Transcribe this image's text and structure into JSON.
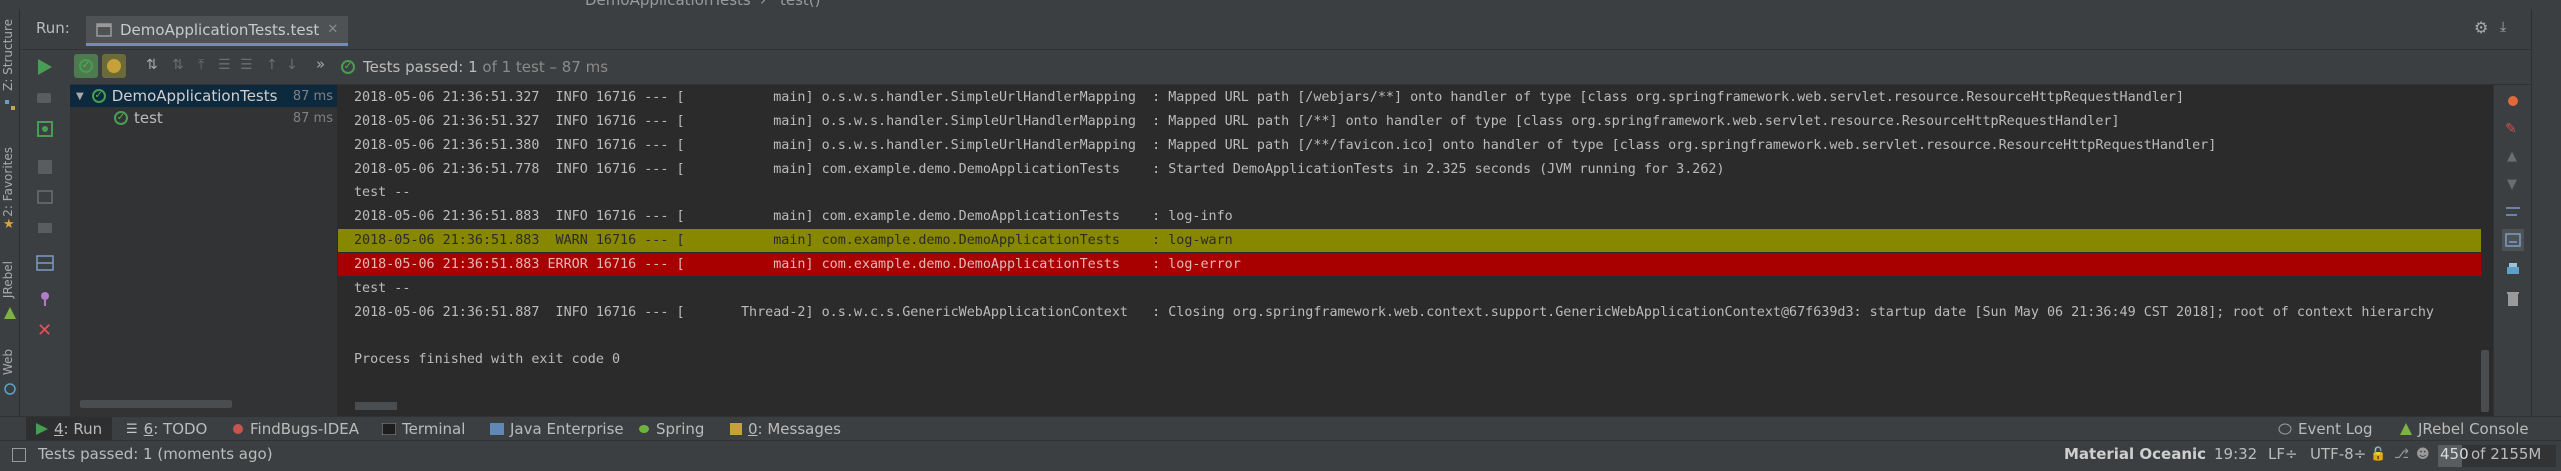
{
  "breadcrumb": {
    "class_name": "DemoApplicationTests",
    "method_name": "test()"
  },
  "left_strip": {
    "structure": "Z: Structure",
    "favorites": "2: Favorites",
    "jrebel": "JRebel",
    "web": "Web"
  },
  "run_panel": {
    "label": "Run:",
    "tab_label": "DemoApplicationTests.test",
    "status_text": "Tests passed:",
    "status_count": "1",
    "status_suffix": "of 1 test – 87 ms",
    "more_chevron": "»"
  },
  "tree": [
    {
      "label": "DemoApplicationTests",
      "time": "87 ms"
    },
    {
      "label": "test",
      "time": "87 ms"
    }
  ],
  "console_lines": [
    {
      "text": "2018-05-06 21:36:51.327  INFO 16716 --- [           main] o.s.w.s.handler.SimpleUrlHandlerMapping  : Mapped URL path [/webjars/**] onto handler of type [class org.springframework.web.servlet.resource.ResourceHttpRequestHandler]",
      "level": "info"
    },
    {
      "text": "2018-05-06 21:36:51.327  INFO 16716 --- [           main] o.s.w.s.handler.SimpleUrlHandlerMapping  : Mapped URL path [/**] onto handler of type [class org.springframework.web.servlet.resource.ResourceHttpRequestHandler]",
      "level": "info"
    },
    {
      "text": "2018-05-06 21:36:51.380  INFO 16716 --- [           main] o.s.w.s.handler.SimpleUrlHandlerMapping  : Mapped URL path [/**/favicon.ico] onto handler of type [class org.springframework.web.servlet.resource.ResourceHttpRequestHandler]",
      "level": "info"
    },
    {
      "text": "2018-05-06 21:36:51.778  INFO 16716 --- [           main] com.example.demo.DemoApplicationTests    : Started DemoApplicationTests in 2.325 seconds (JVM running for 3.262)",
      "level": "info"
    },
    {
      "text": "test --",
      "level": "info"
    },
    {
      "text": "2018-05-06 21:36:51.883  INFO 16716 --- [           main] com.example.demo.DemoApplicationTests    : log-info",
      "level": "info"
    },
    {
      "text": "2018-05-06 21:36:51.883  WARN 16716 --- [           main] com.example.demo.DemoApplicationTests    : log-warn",
      "level": "warn"
    },
    {
      "text": "2018-05-06 21:36:51.883 ERROR 16716 --- [           main] com.example.demo.DemoApplicationTests    : log-error",
      "level": "error"
    },
    {
      "text": "test --",
      "level": "info"
    },
    {
      "text": "2018-05-06 21:36:51.887  INFO 16716 --- [       Thread-2] o.s.w.c.s.GenericWebApplicationContext   : Closing org.springframework.web.context.support.GenericWebApplicationContext@67f639d3: startup date [Sun May 06 21:36:49 CST 2018]; root of context hierarchy",
      "level": "info"
    },
    {
      "text": "",
      "level": "info"
    },
    {
      "text": "Process finished with exit code 0",
      "level": "info"
    }
  ],
  "tool_windows": {
    "run": {
      "num": "4",
      "label": ": Run"
    },
    "todo": {
      "num": "6",
      "label": ": TODO"
    },
    "findbugs": {
      "label": "FindBugs-IDEA"
    },
    "terminal": {
      "label": "Terminal"
    },
    "java_enterprise": {
      "label": "Java Enterprise"
    },
    "spring": {
      "label": "Spring"
    },
    "messages": {
      "num": "0",
      "label": ": Messages"
    },
    "event_log": {
      "label": "Event Log"
    },
    "jrebel_console": {
      "label": "JRebel Console"
    }
  },
  "status_bar": {
    "message": "Tests passed: 1 (moments ago)",
    "theme": "Material Oceanic",
    "position": "19:32",
    "line_sep": "LF÷",
    "encoding": "UTF-8÷",
    "memory_used": "450",
    "memory_total": "of 2155M"
  },
  "colors": {
    "warn_bg": "#888800",
    "error_bg": "#a80000",
    "pass_green": "#499c54",
    "panel_bg": "#3c3f41",
    "console_bg": "#2b2b2b"
  }
}
